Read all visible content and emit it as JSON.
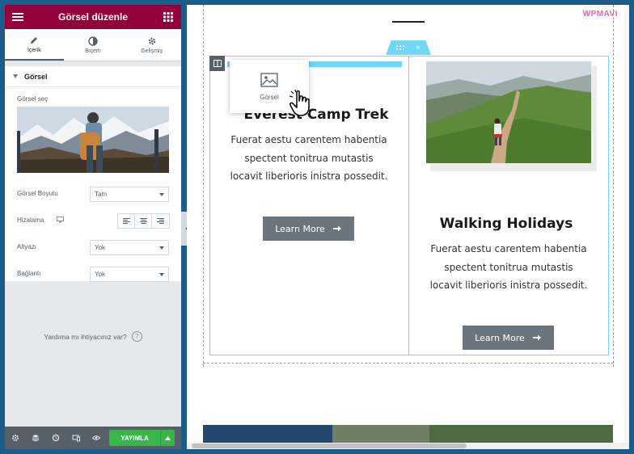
{
  "panel": {
    "title": "Görsel düzenle",
    "tabs": [
      {
        "label": "İçerik",
        "icon": "pencil-icon",
        "active": true
      },
      {
        "label": "Biçem",
        "icon": "contrast-icon",
        "active": false
      },
      {
        "label": "Gelişmiş",
        "icon": "gear-icon",
        "active": false
      }
    ],
    "section_title": "Görsel",
    "controls": {
      "image_label": "Görsel seç",
      "size_label": "Görsel Boyutu",
      "size_value": "Tam",
      "align_label": "Hizalama",
      "caption_label": "Altyazı",
      "caption_value": "Yok",
      "link_label": "Bağlantı",
      "link_value": "Yok"
    },
    "help_text": "Yardıma mı ihtiyacınız var?",
    "help_icon": "?",
    "publish_label": "YAYIMLA"
  },
  "preview": {
    "brand": "WPMAVI",
    "drag_widget_label": "Görsel",
    "left_column": {
      "title": "Everest Camp Trek",
      "text": "Fuerat aestu carentem habentia spectent tonitrua mutastis locavit liberioris inistra possedit.",
      "button": "Learn More"
    },
    "right_column": {
      "title": "Walking Holidays",
      "text": "Fuerat aestu carentem habentia spectent tonitrua mutastis locavit liberioris inistra possedit.",
      "button": "Learn More"
    },
    "section_handle_close": "×"
  },
  "colors": {
    "brand": "#93003c",
    "accent": "#71d7f7",
    "publish": "#39b54a",
    "button": "#6c757d"
  }
}
